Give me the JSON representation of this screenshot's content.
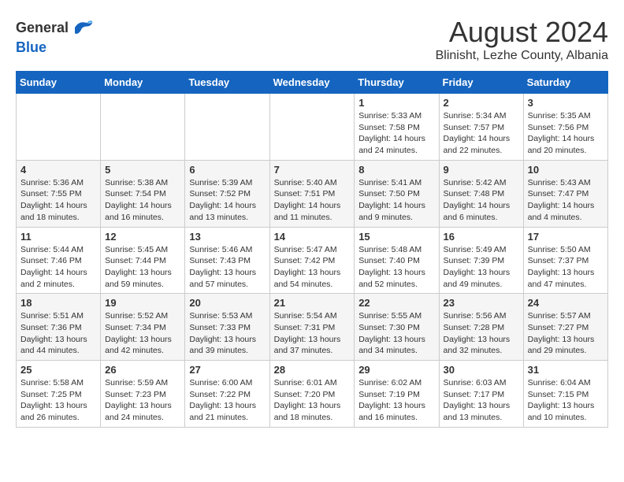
{
  "header": {
    "logo_general": "General",
    "logo_blue": "Blue",
    "month_title": "August 2024",
    "location": "Blinisht, Lezhe County, Albania"
  },
  "days_of_week": [
    "Sunday",
    "Monday",
    "Tuesday",
    "Wednesday",
    "Thursday",
    "Friday",
    "Saturday"
  ],
  "weeks": [
    [
      {
        "day": "",
        "content": ""
      },
      {
        "day": "",
        "content": ""
      },
      {
        "day": "",
        "content": ""
      },
      {
        "day": "",
        "content": ""
      },
      {
        "day": "1",
        "content": "Sunrise: 5:33 AM\nSunset: 7:58 PM\nDaylight: 14 hours\nand 24 minutes."
      },
      {
        "day": "2",
        "content": "Sunrise: 5:34 AM\nSunset: 7:57 PM\nDaylight: 14 hours\nand 22 minutes."
      },
      {
        "day": "3",
        "content": "Sunrise: 5:35 AM\nSunset: 7:56 PM\nDaylight: 14 hours\nand 20 minutes."
      }
    ],
    [
      {
        "day": "4",
        "content": "Sunrise: 5:36 AM\nSunset: 7:55 PM\nDaylight: 14 hours\nand 18 minutes."
      },
      {
        "day": "5",
        "content": "Sunrise: 5:38 AM\nSunset: 7:54 PM\nDaylight: 14 hours\nand 16 minutes."
      },
      {
        "day": "6",
        "content": "Sunrise: 5:39 AM\nSunset: 7:52 PM\nDaylight: 14 hours\nand 13 minutes."
      },
      {
        "day": "7",
        "content": "Sunrise: 5:40 AM\nSunset: 7:51 PM\nDaylight: 14 hours\nand 11 minutes."
      },
      {
        "day": "8",
        "content": "Sunrise: 5:41 AM\nSunset: 7:50 PM\nDaylight: 14 hours\nand 9 minutes."
      },
      {
        "day": "9",
        "content": "Sunrise: 5:42 AM\nSunset: 7:48 PM\nDaylight: 14 hours\nand 6 minutes."
      },
      {
        "day": "10",
        "content": "Sunrise: 5:43 AM\nSunset: 7:47 PM\nDaylight: 14 hours\nand 4 minutes."
      }
    ],
    [
      {
        "day": "11",
        "content": "Sunrise: 5:44 AM\nSunset: 7:46 PM\nDaylight: 14 hours\nand 2 minutes."
      },
      {
        "day": "12",
        "content": "Sunrise: 5:45 AM\nSunset: 7:44 PM\nDaylight: 13 hours\nand 59 minutes."
      },
      {
        "day": "13",
        "content": "Sunrise: 5:46 AM\nSunset: 7:43 PM\nDaylight: 13 hours\nand 57 minutes."
      },
      {
        "day": "14",
        "content": "Sunrise: 5:47 AM\nSunset: 7:42 PM\nDaylight: 13 hours\nand 54 minutes."
      },
      {
        "day": "15",
        "content": "Sunrise: 5:48 AM\nSunset: 7:40 PM\nDaylight: 13 hours\nand 52 minutes."
      },
      {
        "day": "16",
        "content": "Sunrise: 5:49 AM\nSunset: 7:39 PM\nDaylight: 13 hours\nand 49 minutes."
      },
      {
        "day": "17",
        "content": "Sunrise: 5:50 AM\nSunset: 7:37 PM\nDaylight: 13 hours\nand 47 minutes."
      }
    ],
    [
      {
        "day": "18",
        "content": "Sunrise: 5:51 AM\nSunset: 7:36 PM\nDaylight: 13 hours\nand 44 minutes."
      },
      {
        "day": "19",
        "content": "Sunrise: 5:52 AM\nSunset: 7:34 PM\nDaylight: 13 hours\nand 42 minutes."
      },
      {
        "day": "20",
        "content": "Sunrise: 5:53 AM\nSunset: 7:33 PM\nDaylight: 13 hours\nand 39 minutes."
      },
      {
        "day": "21",
        "content": "Sunrise: 5:54 AM\nSunset: 7:31 PM\nDaylight: 13 hours\nand 37 minutes."
      },
      {
        "day": "22",
        "content": "Sunrise: 5:55 AM\nSunset: 7:30 PM\nDaylight: 13 hours\nand 34 minutes."
      },
      {
        "day": "23",
        "content": "Sunrise: 5:56 AM\nSunset: 7:28 PM\nDaylight: 13 hours\nand 32 minutes."
      },
      {
        "day": "24",
        "content": "Sunrise: 5:57 AM\nSunset: 7:27 PM\nDaylight: 13 hours\nand 29 minutes."
      }
    ],
    [
      {
        "day": "25",
        "content": "Sunrise: 5:58 AM\nSunset: 7:25 PM\nDaylight: 13 hours\nand 26 minutes."
      },
      {
        "day": "26",
        "content": "Sunrise: 5:59 AM\nSunset: 7:23 PM\nDaylight: 13 hours\nand 24 minutes."
      },
      {
        "day": "27",
        "content": "Sunrise: 6:00 AM\nSunset: 7:22 PM\nDaylight: 13 hours\nand 21 minutes."
      },
      {
        "day": "28",
        "content": "Sunrise: 6:01 AM\nSunset: 7:20 PM\nDaylight: 13 hours\nand 18 minutes."
      },
      {
        "day": "29",
        "content": "Sunrise: 6:02 AM\nSunset: 7:19 PM\nDaylight: 13 hours\nand 16 minutes."
      },
      {
        "day": "30",
        "content": "Sunrise: 6:03 AM\nSunset: 7:17 PM\nDaylight: 13 hours\nand 13 minutes."
      },
      {
        "day": "31",
        "content": "Sunrise: 6:04 AM\nSunset: 7:15 PM\nDaylight: 13 hours\nand 10 minutes."
      }
    ]
  ]
}
